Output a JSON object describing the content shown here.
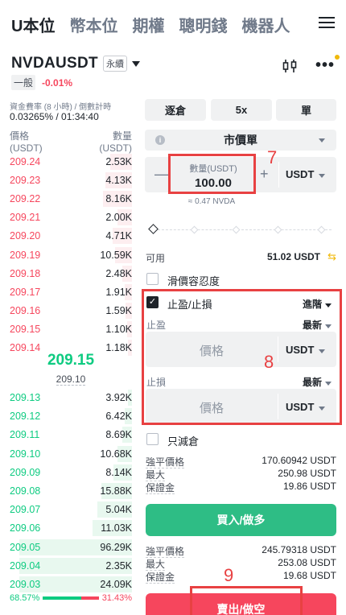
{
  "nav": {
    "tabs": [
      "U本位",
      "幣本位",
      "期權",
      "聰明錢",
      "機器人"
    ]
  },
  "symbol": {
    "name": "NVDAUSDT",
    "perp_tag": "永續",
    "mode_tag": "一般",
    "change": "-0.01%"
  },
  "funding": {
    "label": "資金費率 (8 小時) / 倒數計時",
    "value": "0.03265% / 01:34:40"
  },
  "orderbook": {
    "price_header": "價格",
    "price_unit": "(USDT)",
    "qty_header": "數量",
    "qty_unit": "(USDT)",
    "asks": [
      {
        "price": "209.24",
        "qty": "2.53K",
        "depth": 0.18
      },
      {
        "price": "209.23",
        "qty": "4.13K",
        "depth": 0.22
      },
      {
        "price": "209.22",
        "qty": "8.16K",
        "depth": 0.24
      },
      {
        "price": "209.21",
        "qty": "2.00K",
        "depth": 0.12
      },
      {
        "price": "209.20",
        "qty": "4.71K",
        "depth": 0.16
      },
      {
        "price": "209.19",
        "qty": "10.59K",
        "depth": 0.14
      },
      {
        "price": "209.18",
        "qty": "2.48K",
        "depth": 0.08
      },
      {
        "price": "209.17",
        "qty": "1.91K",
        "depth": 0.06
      },
      {
        "price": "209.16",
        "qty": "1.59K",
        "depth": 0.05
      },
      {
        "price": "209.15",
        "qty": "1.10K",
        "depth": 0.04
      },
      {
        "price": "209.14",
        "qty": "1.18K",
        "depth": 0.03
      }
    ],
    "mid_price": "209.15",
    "mark_price": "209.10",
    "bids": [
      {
        "price": "209.13",
        "qty": "3.92K",
        "depth": 0.03
      },
      {
        "price": "209.12",
        "qty": "6.42K",
        "depth": 0.06
      },
      {
        "price": "209.11",
        "qty": "8.69K",
        "depth": 0.08
      },
      {
        "price": "209.10",
        "qty": "10.68K",
        "depth": 0.12
      },
      {
        "price": "209.09",
        "qty": "8.14K",
        "depth": 0.15
      },
      {
        "price": "209.08",
        "qty": "15.88K",
        "depth": 0.25
      },
      {
        "price": "209.07",
        "qty": "5.04K",
        "depth": 0.28
      },
      {
        "price": "209.06",
        "qty": "11.03K",
        "depth": 0.32
      },
      {
        "price": "209.05",
        "qty": "96.29K",
        "depth": 0.92
      },
      {
        "price": "209.04",
        "qty": "2.35K",
        "depth": 0.92
      },
      {
        "price": "209.03",
        "qty": "24.09K",
        "depth": 0.92
      }
    ],
    "buy_ratio": "68.57%",
    "sell_ratio": "31.43%",
    "buy_ratio_value": 0.6857
  },
  "order": {
    "margin_mode": "逐倉",
    "leverage": "5x",
    "position_mode": "單",
    "order_type": "市價單",
    "qty_label": "數量(USDT)",
    "qty_value": "100.00",
    "qty_unit": "USDT",
    "approx": "≈ 0.47 NVDA",
    "available_label": "可用",
    "available_value": "51.02 USDT",
    "slippage_label": "滑價容忍度",
    "tpsl_label": "止盈/止損",
    "tpsl_mode": "進階",
    "tp_label": "止盈",
    "sl_label": "止損",
    "trigger_type": "最新",
    "price_placeholder": "價格",
    "price_unit": "USDT",
    "reduce_only_label": "只減倉",
    "buy_info": [
      {
        "k": "強平價格",
        "v": "170.60942 USDT"
      },
      {
        "k": "最大",
        "v": "250.98 USDT"
      },
      {
        "k": "保證金",
        "v": "19.86 USDT"
      }
    ],
    "buy_button": "買入/做多",
    "sell_info": [
      {
        "k": "強平價格",
        "v": "245.79318 USDT"
      },
      {
        "k": "最大",
        "v": "253.08 USDT"
      },
      {
        "k": "保證金",
        "v": "19.68 USDT"
      }
    ],
    "sell_button": "賣出/做空"
  },
  "annotations": [
    "7",
    "8",
    "9"
  ],
  "colors": {
    "ask": "#f6465d",
    "bid": "#0ecb81",
    "buy_button": "#2ebd85",
    "sell_button": "#f6465d",
    "annotation": "#e84142"
  }
}
